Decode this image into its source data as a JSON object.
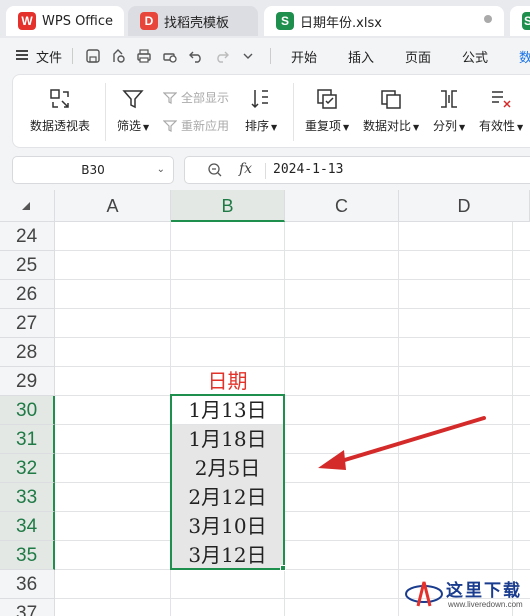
{
  "tabs": [
    {
      "label": "WPS Office",
      "logo": "W"
    },
    {
      "label": "找稻壳模板",
      "logo": "D"
    },
    {
      "label": "日期年份.xlsx",
      "logo": "S"
    },
    {
      "label": "",
      "logo": "S"
    }
  ],
  "menu": {
    "file_label": "文件",
    "items": [
      "开始",
      "插入",
      "页面",
      "公式",
      "数"
    ]
  },
  "ribbon": {
    "pivot": "数据透视表",
    "filter": "筛选",
    "show_all": "全部显示",
    "reapply": "重新应用",
    "sort": "排序",
    "duplicates": "重复项",
    "compare": "数据对比",
    "split": "分列",
    "validity": "有效性"
  },
  "formula_bar": {
    "name_box": "B30",
    "fx": "fx",
    "value": "2024-1-13"
  },
  "sheet": {
    "columns": [
      "A",
      "B",
      "C",
      "D"
    ],
    "selected_column": "B",
    "rows": [
      "24",
      "25",
      "26",
      "27",
      "28",
      "29",
      "30",
      "31",
      "32",
      "33",
      "34",
      "35",
      "36",
      "37"
    ],
    "selected_rows": [
      "30",
      "31",
      "32",
      "33",
      "34",
      "35"
    ],
    "header_cell": "日期",
    "dates": [
      "1月13日",
      "1月18日",
      "2月5日",
      "2月12日",
      "3月10日",
      "3月12日"
    ]
  },
  "colors": {
    "accent_green": "#1f8f4e",
    "header_red": "#e2332b",
    "arrow_red": "#d42a2a"
  },
  "watermark": {
    "text": "这里下载",
    "url": "www.liveredown.com"
  }
}
